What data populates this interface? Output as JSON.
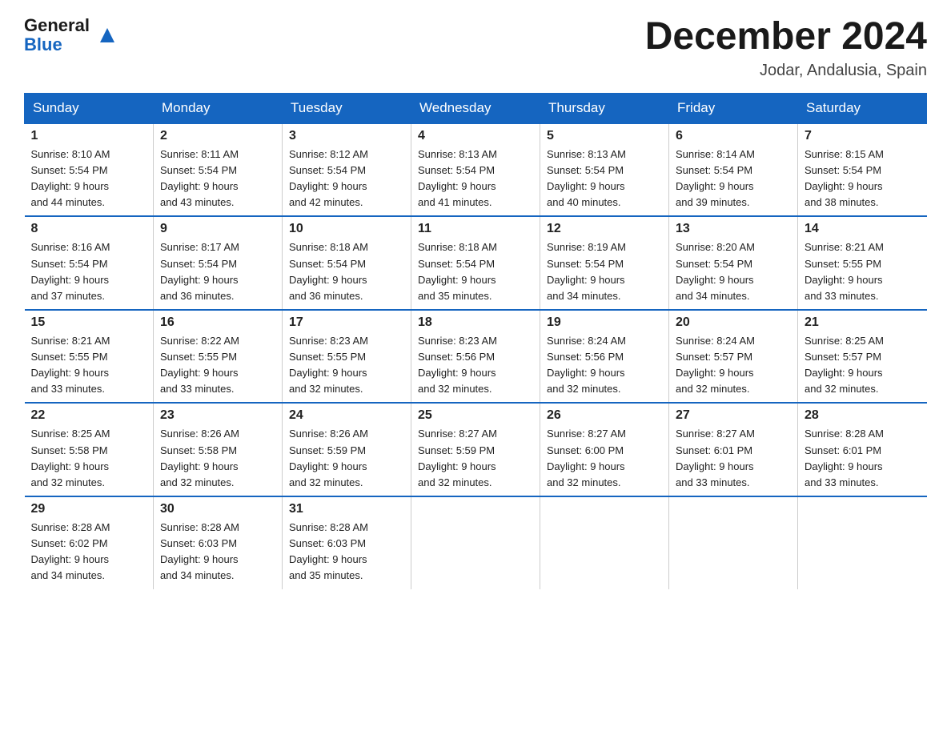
{
  "header": {
    "logo_general": "General",
    "logo_blue": "Blue",
    "month_title": "December 2024",
    "location": "Jodar, Andalusia, Spain"
  },
  "days_of_week": [
    "Sunday",
    "Monday",
    "Tuesday",
    "Wednesday",
    "Thursday",
    "Friday",
    "Saturday"
  ],
  "weeks": [
    [
      {
        "num": "1",
        "sunrise": "8:10 AM",
        "sunset": "5:54 PM",
        "daylight": "9 hours and 44 minutes."
      },
      {
        "num": "2",
        "sunrise": "8:11 AM",
        "sunset": "5:54 PM",
        "daylight": "9 hours and 43 minutes."
      },
      {
        "num": "3",
        "sunrise": "8:12 AM",
        "sunset": "5:54 PM",
        "daylight": "9 hours and 42 minutes."
      },
      {
        "num": "4",
        "sunrise": "8:13 AM",
        "sunset": "5:54 PM",
        "daylight": "9 hours and 41 minutes."
      },
      {
        "num": "5",
        "sunrise": "8:13 AM",
        "sunset": "5:54 PM",
        "daylight": "9 hours and 40 minutes."
      },
      {
        "num": "6",
        "sunrise": "8:14 AM",
        "sunset": "5:54 PM",
        "daylight": "9 hours and 39 minutes."
      },
      {
        "num": "7",
        "sunrise": "8:15 AM",
        "sunset": "5:54 PM",
        "daylight": "9 hours and 38 minutes."
      }
    ],
    [
      {
        "num": "8",
        "sunrise": "8:16 AM",
        "sunset": "5:54 PM",
        "daylight": "9 hours and 37 minutes."
      },
      {
        "num": "9",
        "sunrise": "8:17 AM",
        "sunset": "5:54 PM",
        "daylight": "9 hours and 36 minutes."
      },
      {
        "num": "10",
        "sunrise": "8:18 AM",
        "sunset": "5:54 PM",
        "daylight": "9 hours and 36 minutes."
      },
      {
        "num": "11",
        "sunrise": "8:18 AM",
        "sunset": "5:54 PM",
        "daylight": "9 hours and 35 minutes."
      },
      {
        "num": "12",
        "sunrise": "8:19 AM",
        "sunset": "5:54 PM",
        "daylight": "9 hours and 34 minutes."
      },
      {
        "num": "13",
        "sunrise": "8:20 AM",
        "sunset": "5:54 PM",
        "daylight": "9 hours and 34 minutes."
      },
      {
        "num": "14",
        "sunrise": "8:21 AM",
        "sunset": "5:55 PM",
        "daylight": "9 hours and 33 minutes."
      }
    ],
    [
      {
        "num": "15",
        "sunrise": "8:21 AM",
        "sunset": "5:55 PM",
        "daylight": "9 hours and 33 minutes."
      },
      {
        "num": "16",
        "sunrise": "8:22 AM",
        "sunset": "5:55 PM",
        "daylight": "9 hours and 33 minutes."
      },
      {
        "num": "17",
        "sunrise": "8:23 AM",
        "sunset": "5:55 PM",
        "daylight": "9 hours and 32 minutes."
      },
      {
        "num": "18",
        "sunrise": "8:23 AM",
        "sunset": "5:56 PM",
        "daylight": "9 hours and 32 minutes."
      },
      {
        "num": "19",
        "sunrise": "8:24 AM",
        "sunset": "5:56 PM",
        "daylight": "9 hours and 32 minutes."
      },
      {
        "num": "20",
        "sunrise": "8:24 AM",
        "sunset": "5:57 PM",
        "daylight": "9 hours and 32 minutes."
      },
      {
        "num": "21",
        "sunrise": "8:25 AM",
        "sunset": "5:57 PM",
        "daylight": "9 hours and 32 minutes."
      }
    ],
    [
      {
        "num": "22",
        "sunrise": "8:25 AM",
        "sunset": "5:58 PM",
        "daylight": "9 hours and 32 minutes."
      },
      {
        "num": "23",
        "sunrise": "8:26 AM",
        "sunset": "5:58 PM",
        "daylight": "9 hours and 32 minutes."
      },
      {
        "num": "24",
        "sunrise": "8:26 AM",
        "sunset": "5:59 PM",
        "daylight": "9 hours and 32 minutes."
      },
      {
        "num": "25",
        "sunrise": "8:27 AM",
        "sunset": "5:59 PM",
        "daylight": "9 hours and 32 minutes."
      },
      {
        "num": "26",
        "sunrise": "8:27 AM",
        "sunset": "6:00 PM",
        "daylight": "9 hours and 32 minutes."
      },
      {
        "num": "27",
        "sunrise": "8:27 AM",
        "sunset": "6:01 PM",
        "daylight": "9 hours and 33 minutes."
      },
      {
        "num": "28",
        "sunrise": "8:28 AM",
        "sunset": "6:01 PM",
        "daylight": "9 hours and 33 minutes."
      }
    ],
    [
      {
        "num": "29",
        "sunrise": "8:28 AM",
        "sunset": "6:02 PM",
        "daylight": "9 hours and 34 minutes."
      },
      {
        "num": "30",
        "sunrise": "8:28 AM",
        "sunset": "6:03 PM",
        "daylight": "9 hours and 34 minutes."
      },
      {
        "num": "31",
        "sunrise": "8:28 AM",
        "sunset": "6:03 PM",
        "daylight": "9 hours and 35 minutes."
      },
      null,
      null,
      null,
      null
    ]
  ],
  "labels": {
    "sunrise": "Sunrise:",
    "sunset": "Sunset:",
    "daylight": "Daylight:"
  }
}
